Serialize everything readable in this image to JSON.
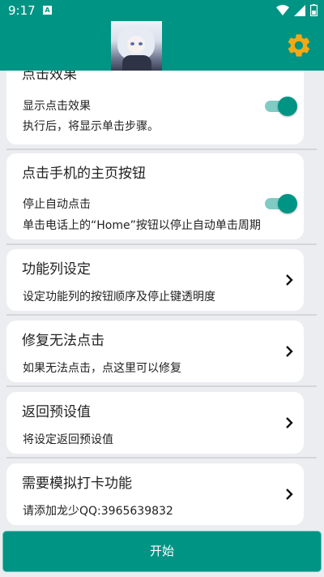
{
  "status_bar": {
    "time": "9:17",
    "notification_glyph": "A"
  },
  "app_bar": {
    "avatar_icon": "anime-avatar",
    "settings_icon": "gear-icon",
    "accent": "#009485",
    "gear_color": "#f4a814"
  },
  "cards": [
    {
      "title": "点击效果",
      "label": "显示点击效果",
      "desc": "执行后，将显示单击步骤。",
      "toggle": true
    },
    {
      "title": "点击手机的主页按钮",
      "label": "停止自动点击",
      "desc": "单击电话上的“Home”按钮以停止自动单击周期",
      "toggle": true
    },
    {
      "title": "功能列设定",
      "desc": "设定功能列的按钮顺序及停止键透明度"
    },
    {
      "title": "修复无法点击",
      "desc": "如果无法点击，点这里可以修复"
    },
    {
      "title": "返回预设值",
      "desc": "将设定返回预设值"
    },
    {
      "title": "需要模拟打卡功能",
      "desc": "请添加龙少QQ:3965639832"
    }
  ],
  "start_button": {
    "label": "开始"
  }
}
